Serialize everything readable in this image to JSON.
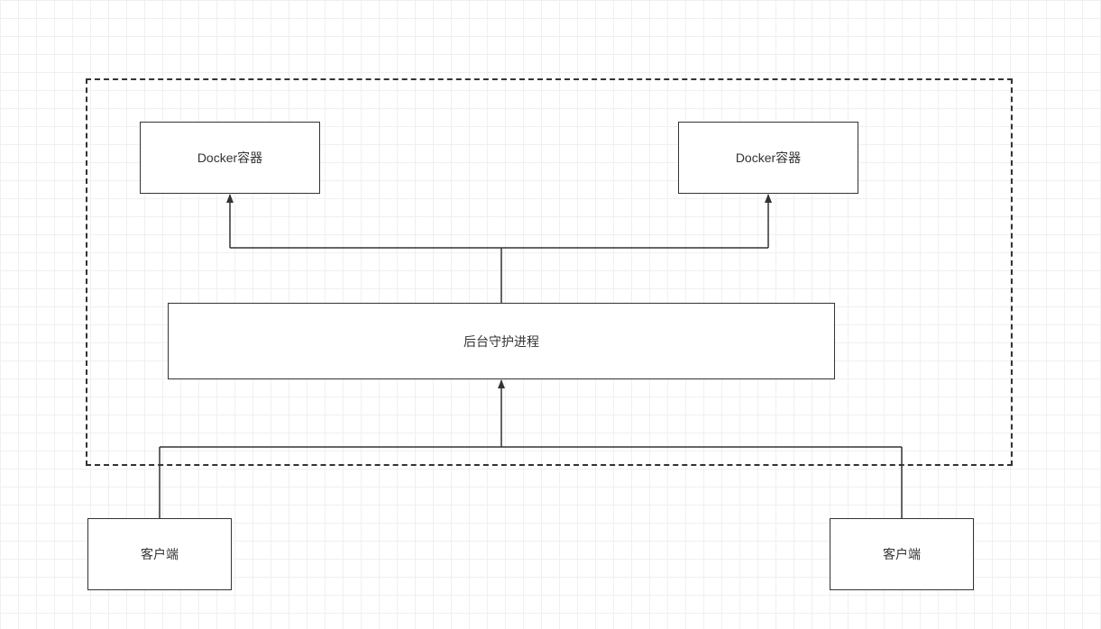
{
  "diagram": {
    "container1_label": "Docker容器",
    "container2_label": "Docker容器",
    "daemon_label": "后台守护进程",
    "client1_label": "客户端",
    "client2_label": "客户端"
  }
}
